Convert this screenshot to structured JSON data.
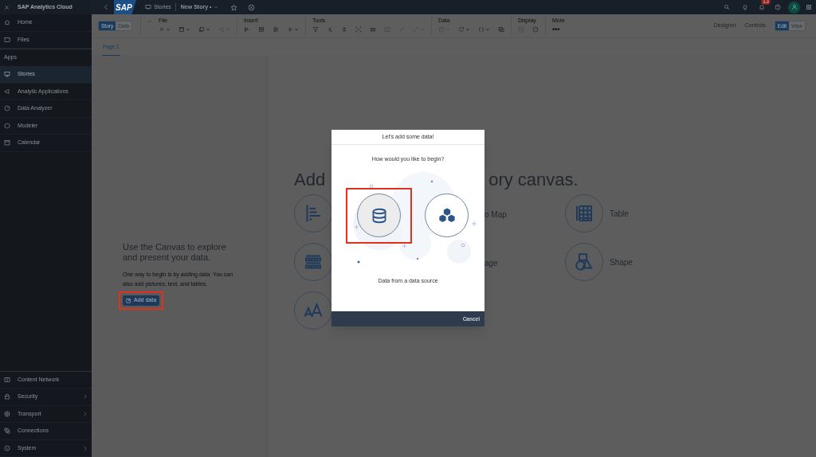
{
  "app_title": "SAP Analytics Cloud",
  "logo": "SAP",
  "sidebar": {
    "top_items": [
      {
        "label": "Home",
        "kind": "home",
        "selected": false
      },
      {
        "label": "Files",
        "kind": "files",
        "selected": false
      }
    ],
    "section_label": "Apps",
    "apps": [
      {
        "label": "Stories",
        "kind": "stories",
        "selected": true
      },
      {
        "label": "Analytic Applications",
        "kind": "applications",
        "selected": false
      },
      {
        "label": "Data Analyzer",
        "kind": "analyzer",
        "selected": false
      },
      {
        "label": "Modeler",
        "kind": "modeler",
        "selected": false
      },
      {
        "label": "Calendar",
        "kind": "calendar",
        "selected": false
      }
    ],
    "bottom_items": [
      {
        "label": "Content Network",
        "kind": "network",
        "expandable": false
      },
      {
        "label": "Security",
        "kind": "security",
        "expandable": true
      },
      {
        "label": "Transport",
        "kind": "transport",
        "expandable": true
      },
      {
        "label": "Connections",
        "kind": "connections",
        "expandable": false
      },
      {
        "label": "System",
        "kind": "system",
        "expandable": true
      }
    ]
  },
  "topbar": {
    "breadcrumb": "Stories",
    "story_title": "New Story •",
    "notification_count": "13"
  },
  "toolbar": {
    "view_toggle": [
      {
        "label": "Story",
        "selected": true
      },
      {
        "label": "Data",
        "selected": false
      }
    ],
    "groups": [
      {
        "label": "File",
        "kind": "file"
      },
      {
        "label": "Insert",
        "kind": "insert"
      },
      {
        "label": "Tools",
        "kind": "tools"
      },
      {
        "label": "Data",
        "kind": "data"
      },
      {
        "label": "Display",
        "kind": "display"
      },
      {
        "label": "More",
        "kind": "more",
        "text": "•••"
      }
    ],
    "mode_links": [
      "Designer",
      "Controls"
    ],
    "edit_toggle": [
      {
        "label": "Edit",
        "selected": true
      },
      {
        "label": "View",
        "selected": false
      }
    ]
  },
  "page_tabs": [
    {
      "label": "Page 1",
      "selected": true
    }
  ],
  "canvas": {
    "intro_title": "Use the Canvas to explore and present your data.",
    "intro_text": "One way to begin is by adding data. You can also add pictures, text, and tables.",
    "add_data_button": {
      "label": "Add data",
      "highlighted": true
    },
    "headline_left": "Add",
    "headline_right": "ory canvas.",
    "rows": [
      {
        "left": {
          "kind": "chart"
        },
        "middle_label": "o Map",
        "right": {
          "kind": "table",
          "label": "Table"
        }
      },
      {
        "left": {
          "kind": "grid"
        },
        "middle_label": "age",
        "right": {
          "kind": "shape",
          "label": "Shape"
        }
      },
      {
        "left": {
          "kind": "text"
        }
      }
    ]
  },
  "modal": {
    "title": "Let's add some data!",
    "prompt": "How would you like to begin?",
    "options": [
      {
        "kind": "datasource",
        "selected": true,
        "highlighted": true
      },
      {
        "kind": "model",
        "selected": false,
        "highlighted": false
      }
    ],
    "caption": "Data from a data source",
    "cancel": "Cancel"
  }
}
